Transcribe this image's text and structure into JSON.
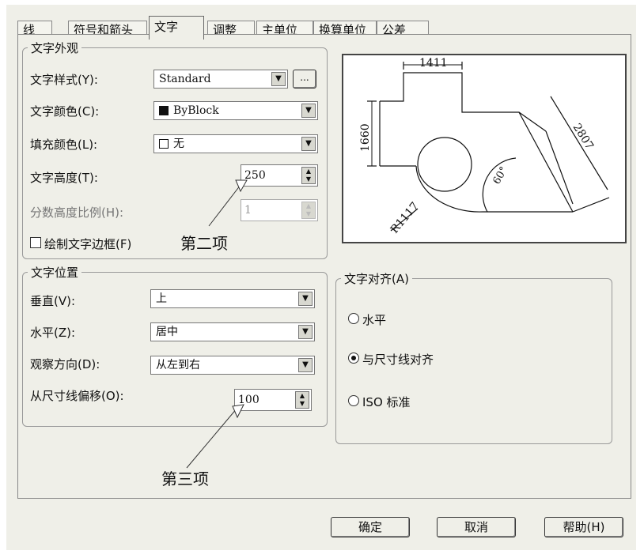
{
  "tabs": [
    {
      "label": "线"
    },
    {
      "label": "符号和箭头"
    },
    {
      "label": "文字"
    },
    {
      "label": "调整"
    },
    {
      "label": "主单位"
    },
    {
      "label": "换算单位"
    },
    {
      "label": "公差"
    }
  ],
  "active_tab": "文字",
  "text_appearance": {
    "title": "文字外观",
    "style_label": "文字样式(Y):",
    "style_value": "Standard",
    "style_browse": "...",
    "color_label": "文字颜色(C):",
    "color_value": "ByBlock",
    "color_swatch": "#111111",
    "fill_label": "填充颜色(L):",
    "fill_value": "无",
    "height_label": "文字高度(T):",
    "height_value": "250",
    "fraction_label": "分数高度比例(H):",
    "fraction_value": "1",
    "frame_label": "绘制文字边框(F)"
  },
  "text_position": {
    "title": "文字位置",
    "vertical_label": "垂直(V):",
    "vertical_value": "上",
    "horizontal_label": "水平(Z):",
    "horizontal_value": "居中",
    "view_dir_label": "观察方向(D):",
    "view_dir_value": "从左到右",
    "offset_label": "从尺寸线偏移(O):",
    "offset_value": "100"
  },
  "text_alignment": {
    "title": "文字对齐(A)",
    "options": [
      "水平",
      "与尺寸线对齐",
      "ISO 标准"
    ],
    "selected": "与尺寸线对齐"
  },
  "preview": {
    "dim_top": "1411",
    "dim_left": "1660",
    "dim_diag": "2807",
    "dim_angle": "60°",
    "dim_radius": "R1117"
  },
  "callouts": {
    "second": "第二项",
    "third": "第三项"
  },
  "buttons": {
    "ok": "确定",
    "cancel": "取消",
    "help": "帮助(H)"
  }
}
